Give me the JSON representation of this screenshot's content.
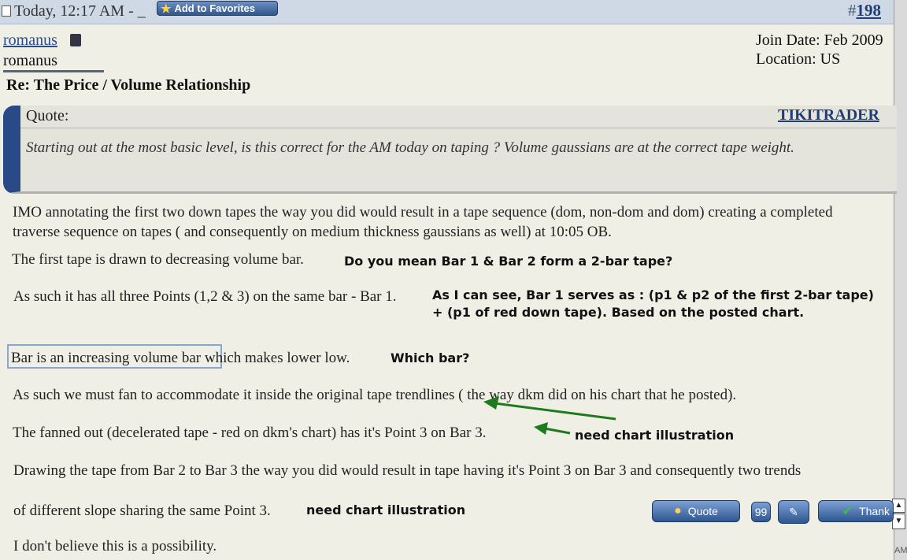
{
  "header": {
    "date": "Today, 12:17 AM - _",
    "add_favorites": "Add to Favorites",
    "post_hash": "#",
    "post_number": "198"
  },
  "user": {
    "name": "romanus",
    "title": "romanus",
    "join_date": "Join Date: Feb 2009",
    "location": "Location: US"
  },
  "post": {
    "title": "Re: The Price / Volume Relationship",
    "quote": {
      "label": "Quote:",
      "author": "TIKITRADER",
      "text": "Starting out at the most basic level, is this correct for the AM today on taping ? Volume gaussians are at the correct tape weight."
    },
    "paragraphs": [
      "IMO annotating the first two down tapes the way you did would result in a tape sequence (dom, non-dom and dom) creating a completed traverse sequence on tapes ( and consequently on medium thickness gaussians as well) at 10:05 OB.",
      "The first tape is drawn to decreasing volume bar.",
      "As such it has all three Points (1,2 & 3) on the same bar - Bar 1.",
      "Bar is an increasing volume bar which makes lower low.",
      "As such we must fan to accommodate it inside the original tape trendlines ( the way dkm did on his chart that he posted).",
      "The fanned out (decelerated tape - red on dkm's chart) has it's Point 3 on Bar 3.",
      "Drawing the tape from Bar 2 to Bar 3 the way you did would result in tape having it's Point 3 on Bar 3 and consequently two trends",
      "of different slope sharing the same Point 3.",
      "I don't believe this is a possibility."
    ],
    "notes": [
      "Do you mean Bar 1 & Bar 2 form a 2-bar tape?",
      "As I can see, Bar  1 serves as : (p1 & p2 of the first 2-bar tape)",
      "+ (p1  of red down tape). Based on the posted chart.",
      "Which bar?",
      "need chart illustration",
      "need chart illustration"
    ]
  },
  "buttons": {
    "quote": "Quote",
    "multi_quote": "99",
    "thanks": "Thank"
  },
  "scrollbar": {
    "up": "▲",
    "down": "▼",
    "label": "AM"
  },
  "colors": {
    "header_bg": "#cfd9e6",
    "link": "#2a4a8c",
    "quote_accent": "#2a4a87",
    "arrow": "#1e7a1e"
  }
}
